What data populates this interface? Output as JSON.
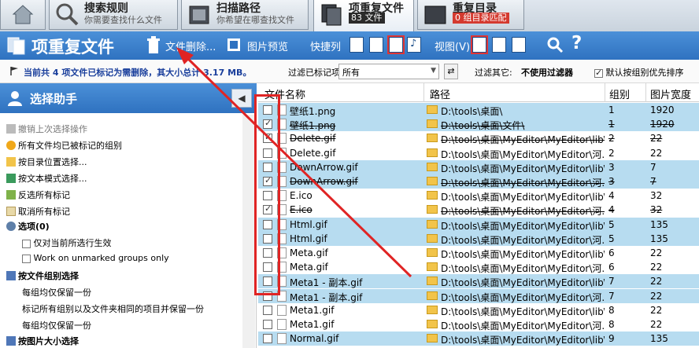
{
  "tabs": [
    {
      "title": "搜索规则",
      "subtitle": "你需要查找什么文件",
      "active": false
    },
    {
      "title": "扫描路径",
      "subtitle": "你希望在哪查找文件",
      "active": false
    },
    {
      "title": "项重复文件",
      "subtitle": "83 文件",
      "active": true
    },
    {
      "title": "重复目录",
      "subtitle": "0 组目录匹配",
      "active": false
    }
  ],
  "toolbar": {
    "title": "项重复文件",
    "delete_label": "文件删除...",
    "preview_label": "图片预览",
    "quick_columns_label": "快捷列",
    "view_label": "视图(V)"
  },
  "statusbar": {
    "message": "当前共 4 项文件已标记为需删除，其大小总计 3.17 MB。",
    "filter_marked_label": "过滤已标记项:",
    "filter_marked_value": "所有",
    "filter_other_label": "过滤其它:",
    "filter_other_value": "不使用过滤器",
    "prefer_dir_label": "默认按组别优先排序"
  },
  "left_panel": {
    "title": "选择助手",
    "items": [
      {
        "label": "撤销上次选择操作",
        "style": "grey",
        "icon": "undo-icon"
      },
      {
        "label": "所有文件均已被标记的组别",
        "style": "normal",
        "icon": "warning-icon"
      },
      {
        "label": "按目录位置选择...",
        "style": "normal",
        "icon": "folder-icon"
      },
      {
        "label": "按文本模式选择...",
        "style": "normal",
        "icon": "text-pattern-icon"
      },
      {
        "label": "反选所有标记",
        "style": "normal",
        "icon": "invert-icon"
      },
      {
        "label": "取消所有标记",
        "style": "normal",
        "icon": "clear-icon"
      },
      {
        "label": "选项(0)",
        "style": "bold",
        "icon": "options-icon"
      },
      {
        "label": "仅对当前所选行生效",
        "style": "check",
        "icon": ""
      },
      {
        "label": "Work on unmarked groups only",
        "style": "check",
        "icon": ""
      },
      {
        "label": "按文件组别选择",
        "style": "bold",
        "icon": "group-icon"
      },
      {
        "label": "每组均仅保留一份",
        "style": "sub",
        "icon": ""
      },
      {
        "label": "标记所有组别以及文件夹相同的项目并保留一份",
        "style": "sub",
        "icon": ""
      },
      {
        "label": "每组均仅保留一份",
        "style": "sub",
        "icon": ""
      },
      {
        "label": "按图片大小选择",
        "style": "bold",
        "icon": "image-size-icon"
      }
    ]
  },
  "grid": {
    "columns": [
      "文件名称",
      "路径",
      "组别",
      "图片宽度"
    ],
    "rows": [
      {
        "checked": false,
        "name": "壁纸1.png",
        "path": "D:\\tools\\桌面\\",
        "group": "1",
        "width": "1920",
        "bg": "blue",
        "struck": false
      },
      {
        "checked": true,
        "name": "壁纸1.png",
        "path": "D:\\tools\\桌面\\文件\\",
        "group": "1",
        "width": "1920",
        "bg": "blue",
        "struck": true
      },
      {
        "checked": true,
        "name": "Delete.gif",
        "path": "D:\\tools\\桌面\\MyEditor\\MyEditor\\lib\\",
        "group": "2",
        "width": "22",
        "bg": "white",
        "struck": true
      },
      {
        "checked": false,
        "name": "Delete.gif",
        "path": "D:\\tools\\桌面\\MyEditor\\MyEditor\\河...",
        "group": "2",
        "width": "22",
        "bg": "white",
        "struck": false
      },
      {
        "checked": false,
        "name": "DownArrow.gif",
        "path": "D:\\tools\\桌面\\MyEditor\\MyEditor\\lib\\",
        "group": "3",
        "width": "7",
        "bg": "blue",
        "struck": false
      },
      {
        "checked": true,
        "name": "DownArrow.gif",
        "path": "D:\\tools\\桌面\\MyEditor\\MyEditor\\河...",
        "group": "3",
        "width": "7",
        "bg": "blue",
        "struck": true
      },
      {
        "checked": false,
        "name": "E.ico",
        "path": "D:\\tools\\桌面\\MyEditor\\MyEditor\\lib\\",
        "group": "4",
        "width": "32",
        "bg": "white",
        "struck": false
      },
      {
        "checked": true,
        "name": "E.ico",
        "path": "D:\\tools\\桌面\\MyEditor\\MyEditor\\河...",
        "group": "4",
        "width": "32",
        "bg": "white",
        "struck": true
      },
      {
        "checked": false,
        "name": "Html.gif",
        "path": "D:\\tools\\桌面\\MyEditor\\MyEditor\\lib\\",
        "group": "5",
        "width": "135",
        "bg": "blue",
        "struck": false
      },
      {
        "checked": false,
        "name": "Html.gif",
        "path": "D:\\tools\\桌面\\MyEditor\\MyEditor\\河...",
        "group": "5",
        "width": "135",
        "bg": "blue",
        "struck": false
      },
      {
        "checked": false,
        "name": "Meta.gif",
        "path": "D:\\tools\\桌面\\MyEditor\\MyEditor\\lib\\",
        "group": "6",
        "width": "22",
        "bg": "white",
        "struck": false
      },
      {
        "checked": false,
        "name": "Meta.gif",
        "path": "D:\\tools\\桌面\\MyEditor\\MyEditor\\河...",
        "group": "6",
        "width": "22",
        "bg": "white",
        "struck": false
      },
      {
        "checked": false,
        "name": "Meta1 - 副本.gif",
        "path": "D:\\tools\\桌面\\MyEditor\\MyEditor\\lib\\",
        "group": "7",
        "width": "22",
        "bg": "blue",
        "struck": false
      },
      {
        "checked": false,
        "name": "Meta1 - 副本.gif",
        "path": "D:\\tools\\桌面\\MyEditor\\MyEditor\\河...",
        "group": "7",
        "width": "22",
        "bg": "blue",
        "struck": false
      },
      {
        "checked": false,
        "name": "Meta1.gif",
        "path": "D:\\tools\\桌面\\MyEditor\\MyEditor\\lib\\",
        "group": "8",
        "width": "22",
        "bg": "white",
        "struck": false
      },
      {
        "checked": false,
        "name": "Meta1.gif",
        "path": "D:\\tools\\桌面\\MyEditor\\MyEditor\\河...",
        "group": "8",
        "width": "22",
        "bg": "white",
        "struck": false
      },
      {
        "checked": false,
        "name": "Normal.gif",
        "path": "D:\\tools\\桌面\\MyEditor\\MyEditor\\lib\\",
        "group": "9",
        "width": "135",
        "bg": "blue",
        "struck": false
      }
    ]
  },
  "colors": {
    "toolbar_blue": "#2f72c0",
    "row_blue": "#b7dcf0",
    "annotation_red": "#e02424",
    "badge_dark": "#2b2b2b",
    "badge_red": "#d43a2f"
  }
}
